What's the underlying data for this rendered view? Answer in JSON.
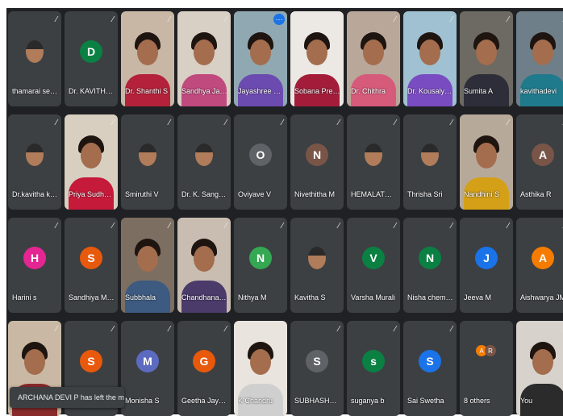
{
  "participants": [
    {
      "name": "thamarai selvan",
      "kind": "photo"
    },
    {
      "name": "Dr. KAVITHA R. J.",
      "initial": "D",
      "color": "#0b8043",
      "kind": "initial"
    },
    {
      "name": "Dr. Shanthi S",
      "kind": "video",
      "shirt": "#b3223a",
      "bg": "#c9b7a6"
    },
    {
      "name": "Sandhya Jaya...",
      "kind": "video",
      "shirt": "#c0497d",
      "bg": "#d8cfc5"
    },
    {
      "name": "Jayashree Gh...",
      "kind": "video",
      "shirt": "#6c4bb0",
      "bg": "#8fa8b2",
      "active": true
    },
    {
      "name": "Sobana Premi...",
      "kind": "video",
      "shirt": "#a31d3b",
      "bg": "#ece8e4"
    },
    {
      "name": "Dr. Chithra",
      "kind": "video",
      "shirt": "#d65a7a",
      "bg": "#b9a79a"
    },
    {
      "name": "Dr. Kousalya R",
      "kind": "video",
      "shirt": "#7a4cc2",
      "bg": "#9fc1d2"
    },
    {
      "name": "Sumita A",
      "kind": "video",
      "shirt": "#2e2e3a",
      "bg": "#6c6a62"
    },
    {
      "name": "kavithadevi",
      "kind": "video",
      "shirt": "#1f7a8c",
      "bg": "#6e7f8a"
    },
    {
      "name": "Dr.kavitha kum...",
      "kind": "photo"
    },
    {
      "name": "Priya Sudha K",
      "kind": "video",
      "shirt": "#c61a3a",
      "bg": "#d8cfc0"
    },
    {
      "name": "Smiruthi V",
      "kind": "photo"
    },
    {
      "name": "Dr. K. Sangeeth...",
      "kind": "photo"
    },
    {
      "name": "Oviyave V",
      "initial": "O",
      "color": "#5f6368",
      "kind": "initial"
    },
    {
      "name": "Nivethitha M",
      "initial": "N",
      "color": "#795548",
      "kind": "initial"
    },
    {
      "name": "HEMALATHA G.B",
      "kind": "photo"
    },
    {
      "name": "Thrisha Sri",
      "kind": "photo"
    },
    {
      "name": "Nandhini S",
      "kind": "video",
      "shirt": "#d4a017",
      "bg": "#b7a99a"
    },
    {
      "name": "Asthika R",
      "initial": "A",
      "color": "#795548",
      "kind": "initial"
    },
    {
      "name": "Harini s",
      "initial": "H",
      "color": "#e52592",
      "kind": "initial"
    },
    {
      "name": "Sandhiya Moha...",
      "initial": "S",
      "color": "#e8590c",
      "kind": "initial"
    },
    {
      "name": "Subbhala",
      "kind": "video",
      "shirt": "#3d5a80",
      "bg": "#7c6f62"
    },
    {
      "name": "Chandhana C...",
      "kind": "video",
      "shirt": "#4a3b6b",
      "bg": "#c8bdb0"
    },
    {
      "name": "Nithya M",
      "initial": "N",
      "color": "#34a853",
      "kind": "initial"
    },
    {
      "name": "Kavitha S",
      "kind": "photo"
    },
    {
      "name": "Varsha Murali",
      "initial": "V",
      "color": "#0b8043",
      "kind": "initial"
    },
    {
      "name": "Nisha chemistry",
      "initial": "N",
      "color": "#0b8043",
      "kind": "initial"
    },
    {
      "name": "Jeeva M",
      "initial": "J",
      "color": "#1a73e8",
      "kind": "initial"
    },
    {
      "name": "Aishwarya JM",
      "initial": "A",
      "color": "#f57c00",
      "kind": "initial"
    },
    {
      "name": "",
      "kind": "video",
      "shirt": "#8a2b2b",
      "bg": "#c9b9a4"
    },
    {
      "name": "",
      "initial": "S",
      "color": "#e8590c",
      "kind": "initial"
    },
    {
      "name": "Monisha S",
      "initial": "M",
      "color": "#5c6bc0",
      "kind": "initial"
    },
    {
      "name": "Geetha Jayara...",
      "initial": "G",
      "color": "#e8590c",
      "kind": "initial"
    },
    {
      "name": "K Chandru",
      "kind": "video",
      "shirt": "#cfcfcf",
      "bg": "#e9e4de"
    },
    {
      "name": "SUBHASHREE A",
      "initial": "S",
      "color": "#5f6368",
      "kind": "initial"
    },
    {
      "name": "suganya b",
      "initial": "s",
      "color": "#0b8043",
      "kind": "initial"
    },
    {
      "name": "Sai Swetha",
      "initial": "S",
      "color": "#1a73e8",
      "kind": "initial"
    },
    {
      "name": "8 others",
      "kind": "others",
      "mini": [
        {
          "l": "A",
          "c": "#f57c00"
        },
        {
          "l": "R",
          "c": "#795548"
        }
      ]
    },
    {
      "name": "You",
      "kind": "video",
      "shirt": "#2b2b2b",
      "bg": "#d7d2cc"
    }
  ],
  "icons": {
    "mic_off": "mic-off-icon",
    "more": "more-options-icon"
  },
  "toast": {
    "text": "ARCHANA DEVI P has left the meeting"
  }
}
